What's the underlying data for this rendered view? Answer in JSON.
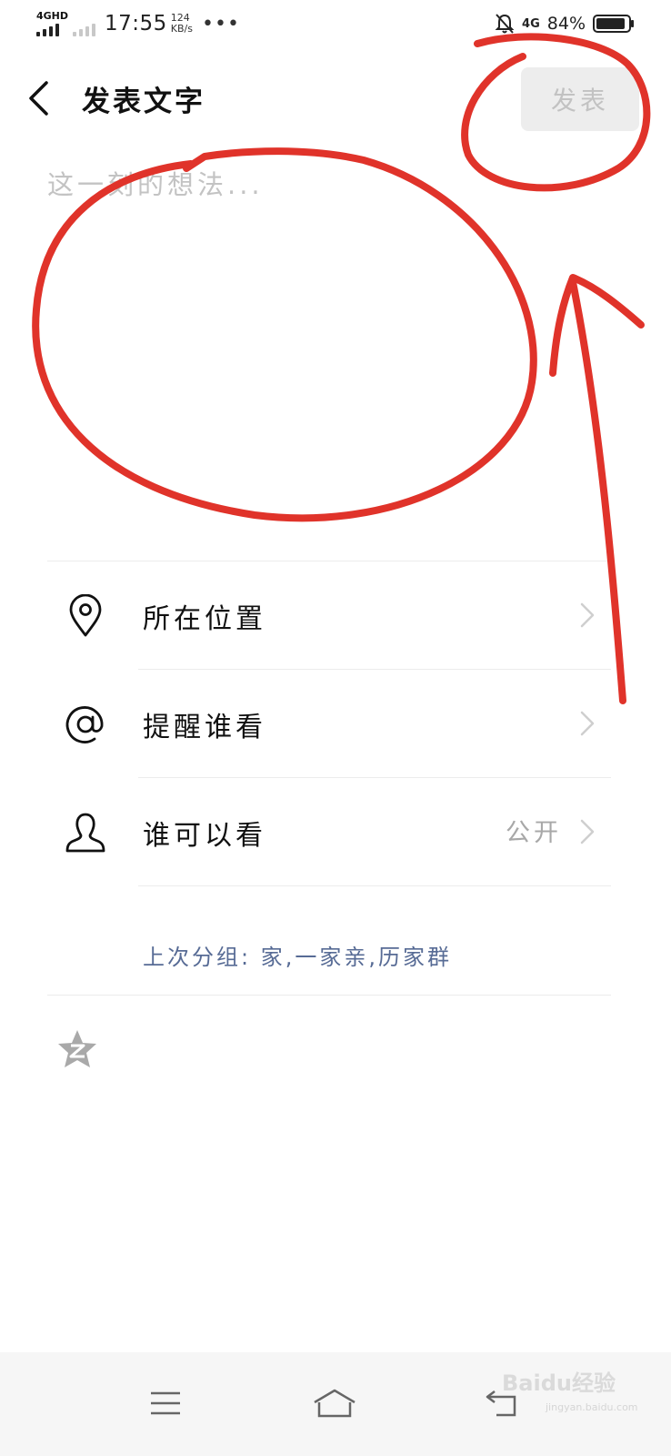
{
  "status_bar": {
    "network": "4GHD",
    "time": "17:55",
    "speed_value": "124",
    "speed_unit": "KB/s",
    "more": "•••",
    "right_network": "4G",
    "battery": "84%",
    "icons": [
      "signal-icon",
      "mute-icon",
      "battery-icon"
    ]
  },
  "header": {
    "title": "发表文字",
    "publish_label": "发表",
    "back_icon": "chevron-left-icon"
  },
  "composer": {
    "placeholder": "这一刻的想法..."
  },
  "options": [
    {
      "icon": "location-pin-icon",
      "label": "所在位置",
      "value": ""
    },
    {
      "icon": "at-sign-icon",
      "label": "提醒谁看",
      "value": ""
    },
    {
      "icon": "person-icon",
      "label": "谁可以看",
      "value": "公开"
    }
  ],
  "last_group": "上次分组:  家,一家亲,历家群",
  "qzone_icon": "qzone-star-icon",
  "bottom_nav": [
    "menu-icon",
    "home-icon",
    "back-icon"
  ],
  "watermark": {
    "brand": "Baidu经验",
    "url": "jingyan.baidu.com"
  },
  "colors": {
    "link": "#576b95",
    "annotation": "#e0332a",
    "publish_disabled_bg": "#ededed",
    "publish_disabled_text": "#c2c2c2"
  }
}
